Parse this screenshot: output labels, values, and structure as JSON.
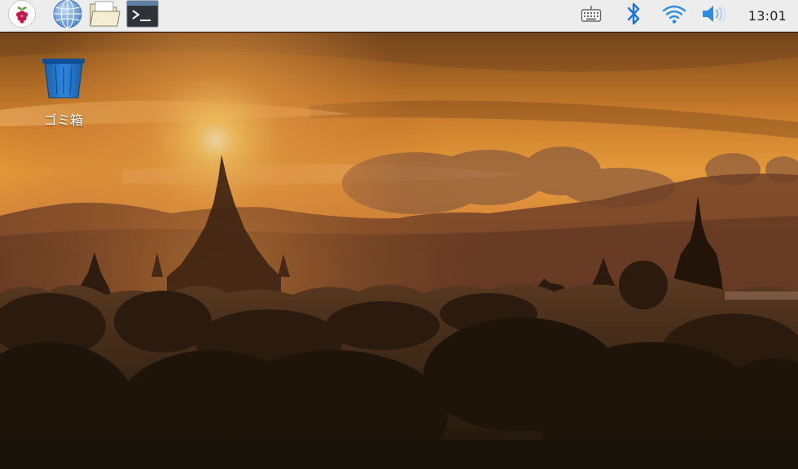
{
  "taskbar": {
    "launchers": [
      {
        "icon": "raspberry-menu-icon"
      },
      {
        "icon": "globe-browser-icon"
      },
      {
        "icon": "folder-file-manager-icon"
      },
      {
        "icon": "terminal-icon"
      }
    ],
    "tray": {
      "keyboard_icon": "keyboard-icon",
      "bluetooth_icon": "bluetooth-icon",
      "wifi_icon": "wifi-icon",
      "volume_icon": "volume-icon",
      "clock": "13:01"
    }
  },
  "desktop": {
    "icons": [
      {
        "label": "ゴミ箱",
        "icon": "trash-icon"
      }
    ]
  },
  "colors": {
    "panel_bg": "#ededed",
    "trash_blue": "#1f74c8",
    "bluetooth_blue": "#1a73e8",
    "tray_accent": "#2b8de3"
  }
}
